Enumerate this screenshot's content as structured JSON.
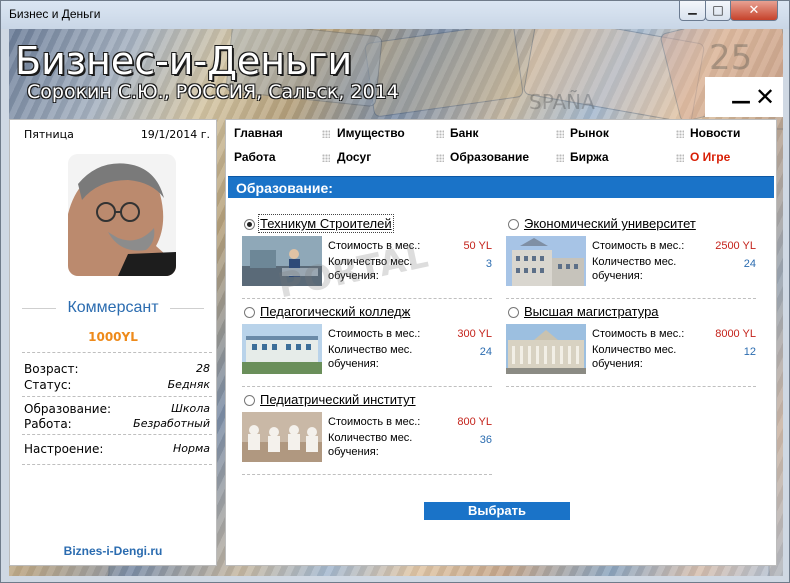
{
  "window": {
    "title": "Бизнес и Деньги",
    "min_glyph": "▁",
    "max_glyph": "□",
    "close_glyph": "✕"
  },
  "banner": {
    "title": "Бизнес-и-Деньги",
    "subtitle": "Сорокин С.Ю., РОССИЯ, Сальск, 2014",
    "minimize_glyph": "—",
    "close_glyph": "✕"
  },
  "profile": {
    "day": "Пятница",
    "date": "19/1/2014 г.",
    "rank": "Коммерсант",
    "money": "1000YL",
    "age_label": "Возраст:",
    "age_value": "28",
    "status_label": "Статус:",
    "status_value": "Бедняк",
    "education_label": "Образование:",
    "education_value": "Школа",
    "job_label": "Работа:",
    "job_value": "Безработный",
    "mood_label": "Настроение:",
    "mood_value": "Норма",
    "site": "Biznes-i-Dengi.ru"
  },
  "menu": {
    "items": [
      {
        "label": "Главная"
      },
      {
        "label": "Имущество"
      },
      {
        "label": "Банк"
      },
      {
        "label": "Рынок"
      },
      {
        "label": "Новости"
      },
      {
        "label": "Работа"
      },
      {
        "label": "Досуг"
      },
      {
        "label": "Образование"
      },
      {
        "label": "Биржа"
      },
      {
        "label": "О Игре"
      }
    ]
  },
  "section": {
    "title": "Образование:"
  },
  "options": [
    {
      "name": "Техникум Строителей",
      "cost_label": "Стоимость в мес.:",
      "cost": "50 YL",
      "months_label_1": "Количество мес.",
      "months_label_2": "обучения:",
      "months": "3",
      "selected": true
    },
    {
      "name": "Экономический университет",
      "cost_label": "Стоимость в мес.:",
      "cost": "2500 YL",
      "months_label_1": "Количество мес.",
      "months_label_2": "обучения:",
      "months": "24",
      "selected": false
    },
    {
      "name": "Педагогический колледж",
      "cost_label": "Стоимость в мес.:",
      "cost": "300 YL",
      "months_label_1": "Количество мес.",
      "months_label_2": "обучения:",
      "months": "24",
      "selected": false
    },
    {
      "name": "Высшая магистратура",
      "cost_label": "Стоимость в мес.:",
      "cost": "8000 YL",
      "months_label_1": "Количество мес.",
      "months_label_2": "обучения:",
      "months": "12",
      "selected": false
    },
    {
      "name": "Педиатрический институт",
      "cost_label": "Стоимость в мес.:",
      "cost": "800 YL",
      "months_label_1": "Количество мес.",
      "months_label_2": "обучения:",
      "months": "36",
      "selected": false
    }
  ],
  "actions": {
    "choose_label": "Выбрать"
  },
  "watermark": "PORTAL",
  "colors": {
    "accent": "#1a73c8",
    "price": "#c4231b",
    "months": "#2b6cb0",
    "money": "#ee8a1a",
    "about_menu": "#d81e05"
  }
}
